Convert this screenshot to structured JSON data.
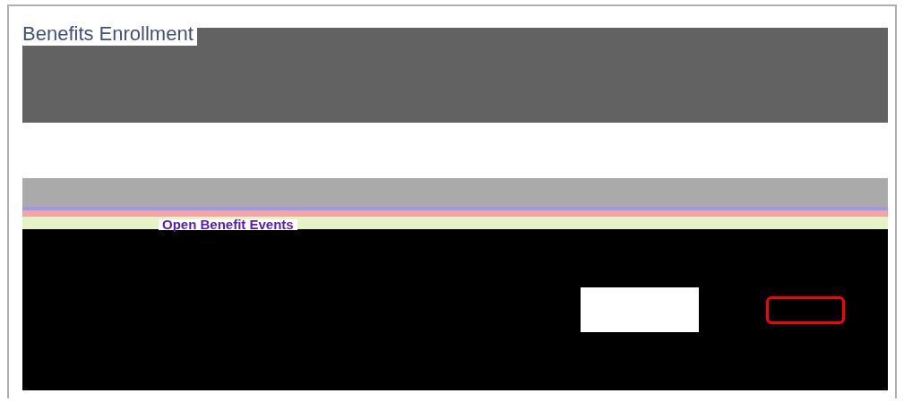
{
  "page": {
    "title": "Benefits Enrollment"
  },
  "section": {
    "heading": "Open Benefit Events"
  }
}
